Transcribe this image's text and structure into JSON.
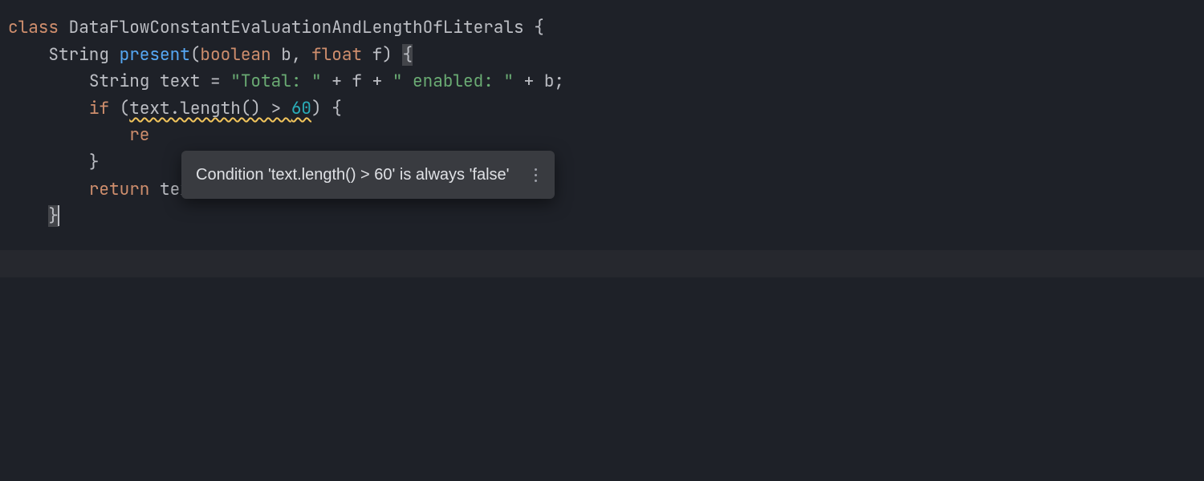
{
  "code": {
    "line1": {
      "kw_class": "class",
      "class_name": " DataFlowConstantEvaluationAndLengthOfLiterals ",
      "brace": "{"
    },
    "line2": {
      "indent": "    ",
      "return_type": "String ",
      "method_name": "present",
      "paren_open": "(",
      "param1_type": "boolean",
      "param1_name": " b",
      "comma": ", ",
      "param2_type": "float",
      "param2_name": " f",
      "paren_close": ") ",
      "brace": "{"
    },
    "line3": {
      "indent": "        ",
      "decl": "String text = ",
      "str1": "\"Total: \"",
      "plus1": " + f + ",
      "str2": "\" enabled: \"",
      "plus2": " + b;"
    },
    "line4": {
      "indent": "        ",
      "kw_if": "if",
      "pre_cond": " (",
      "cond_call": "text.length() > ",
      "cond_num": "60",
      "post_cond": ") {"
    },
    "line5": {
      "indent": "            ",
      "partial_return": "re"
    },
    "line6": {
      "indent": "        ",
      "brace": "}"
    },
    "line7": {
      "indent": "        ",
      "kw_return": "return",
      "rest": " text;"
    },
    "line8": {
      "indent": "    ",
      "brace": "}"
    }
  },
  "tooltip": {
    "message": "Condition 'text.length() > 60' is always 'false'"
  }
}
